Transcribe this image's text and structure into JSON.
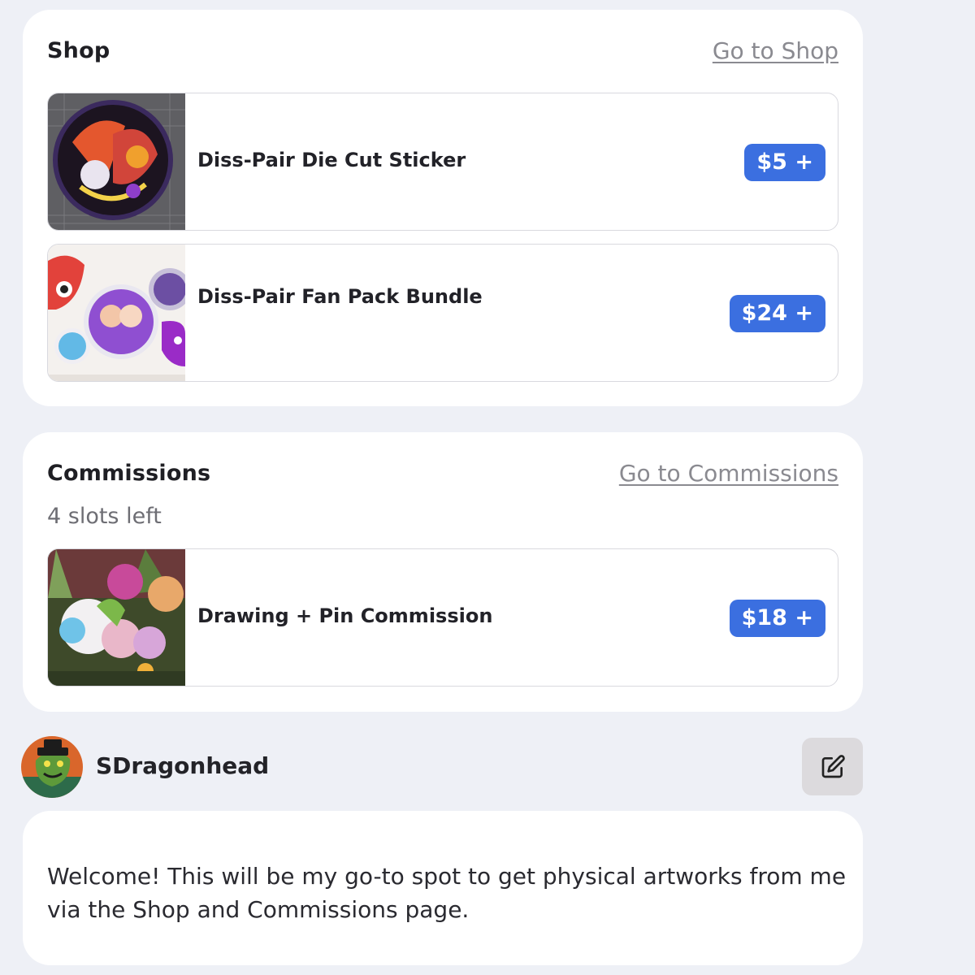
{
  "shop": {
    "title": "Shop",
    "link_label": "Go to Shop",
    "items": [
      {
        "name": "Diss-Pair Die Cut Sticker",
        "price": "$5 +"
      },
      {
        "name": "Diss-Pair Fan Pack Bundle",
        "price": "$24 +"
      }
    ]
  },
  "commissions": {
    "title": "Commissions",
    "link_label": "Go to Commissions",
    "slots_text": "4 slots left",
    "items": [
      {
        "name": "Drawing + Pin Commission",
        "price": "$18 +"
      }
    ]
  },
  "profile": {
    "username": "SDragonhead",
    "edit_icon": "edit-icon",
    "bio": "Welcome! This will be my go-to spot to get physical artworks from me via the Shop and Commissions page."
  },
  "colors": {
    "accent": "#3b6fe0",
    "background": "#eef0f6",
    "card": "#ffffff",
    "muted_text": "#8a8a90"
  }
}
